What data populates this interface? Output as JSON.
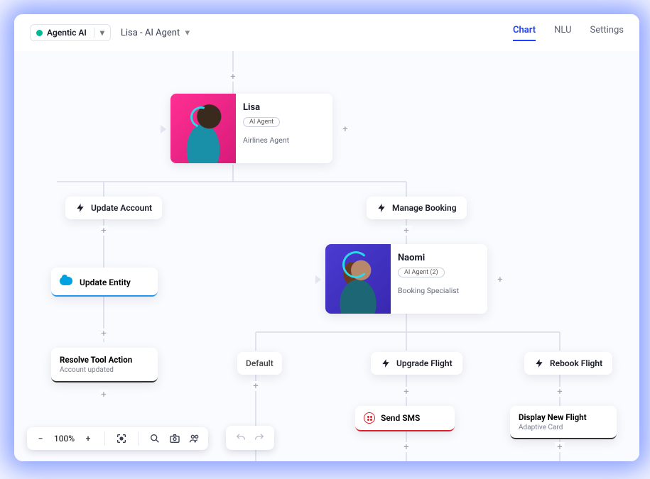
{
  "header": {
    "agent_badge": "Agentic AI",
    "breadcrumb": "Lisa - AI Agent"
  },
  "nav": {
    "chart": "Chart",
    "nlu": "NLU",
    "settings": "Settings"
  },
  "agents": {
    "lisa": {
      "name": "Lisa",
      "tag": "AI Agent",
      "subtitle": "Airlines Agent"
    },
    "naomi": {
      "name": "Naomi",
      "tag": "AI Agent (2)",
      "subtitle": "Booking Specialist"
    }
  },
  "nodes": {
    "update_account": "Update Account",
    "manage_booking": "Manage Booking",
    "update_entity": "Update Entity",
    "resolve_title": "Resolve Tool Action",
    "resolve_sub": "Account updated",
    "default": "Default",
    "upgrade_flight": "Upgrade Flight",
    "rebook_flight": "Rebook Flight",
    "send_sms": "Send SMS",
    "display_new_flight": "Display New Flight",
    "display_sub": "Adaptive Card"
  },
  "toolbar": {
    "zoom": "100%"
  }
}
